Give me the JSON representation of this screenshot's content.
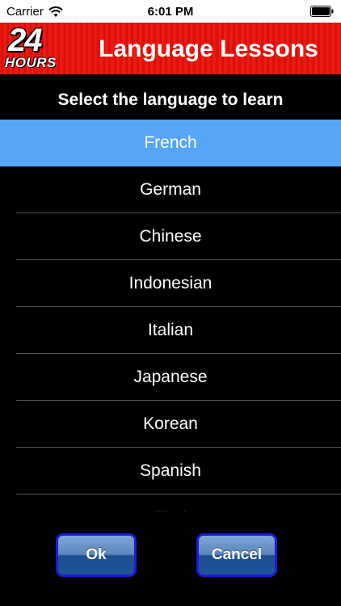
{
  "status_bar": {
    "carrier": "Carrier",
    "time": "6:01 PM"
  },
  "header": {
    "logo_number": "24",
    "logo_word": "HOURS",
    "title": "Language Lessons",
    "color": "#e8130c"
  },
  "prompt": "Select the language to learn",
  "languages": [
    {
      "label": "French",
      "selected": true
    },
    {
      "label": "German",
      "selected": false
    },
    {
      "label": "Chinese",
      "selected": false
    },
    {
      "label": "Indonesian",
      "selected": false
    },
    {
      "label": "Italian",
      "selected": false
    },
    {
      "label": "Japanese",
      "selected": false
    },
    {
      "label": "Korean",
      "selected": false
    },
    {
      "label": "Spanish",
      "selected": false
    },
    {
      "label": "Thai",
      "selected": false
    }
  ],
  "buttons": {
    "ok": "Ok",
    "cancel": "Cancel"
  },
  "colors": {
    "selected_row": "#56a5f8",
    "button_border": "#1b1bd8"
  },
  "icons": {
    "wifi": "wifi-icon",
    "battery": "battery-icon"
  }
}
